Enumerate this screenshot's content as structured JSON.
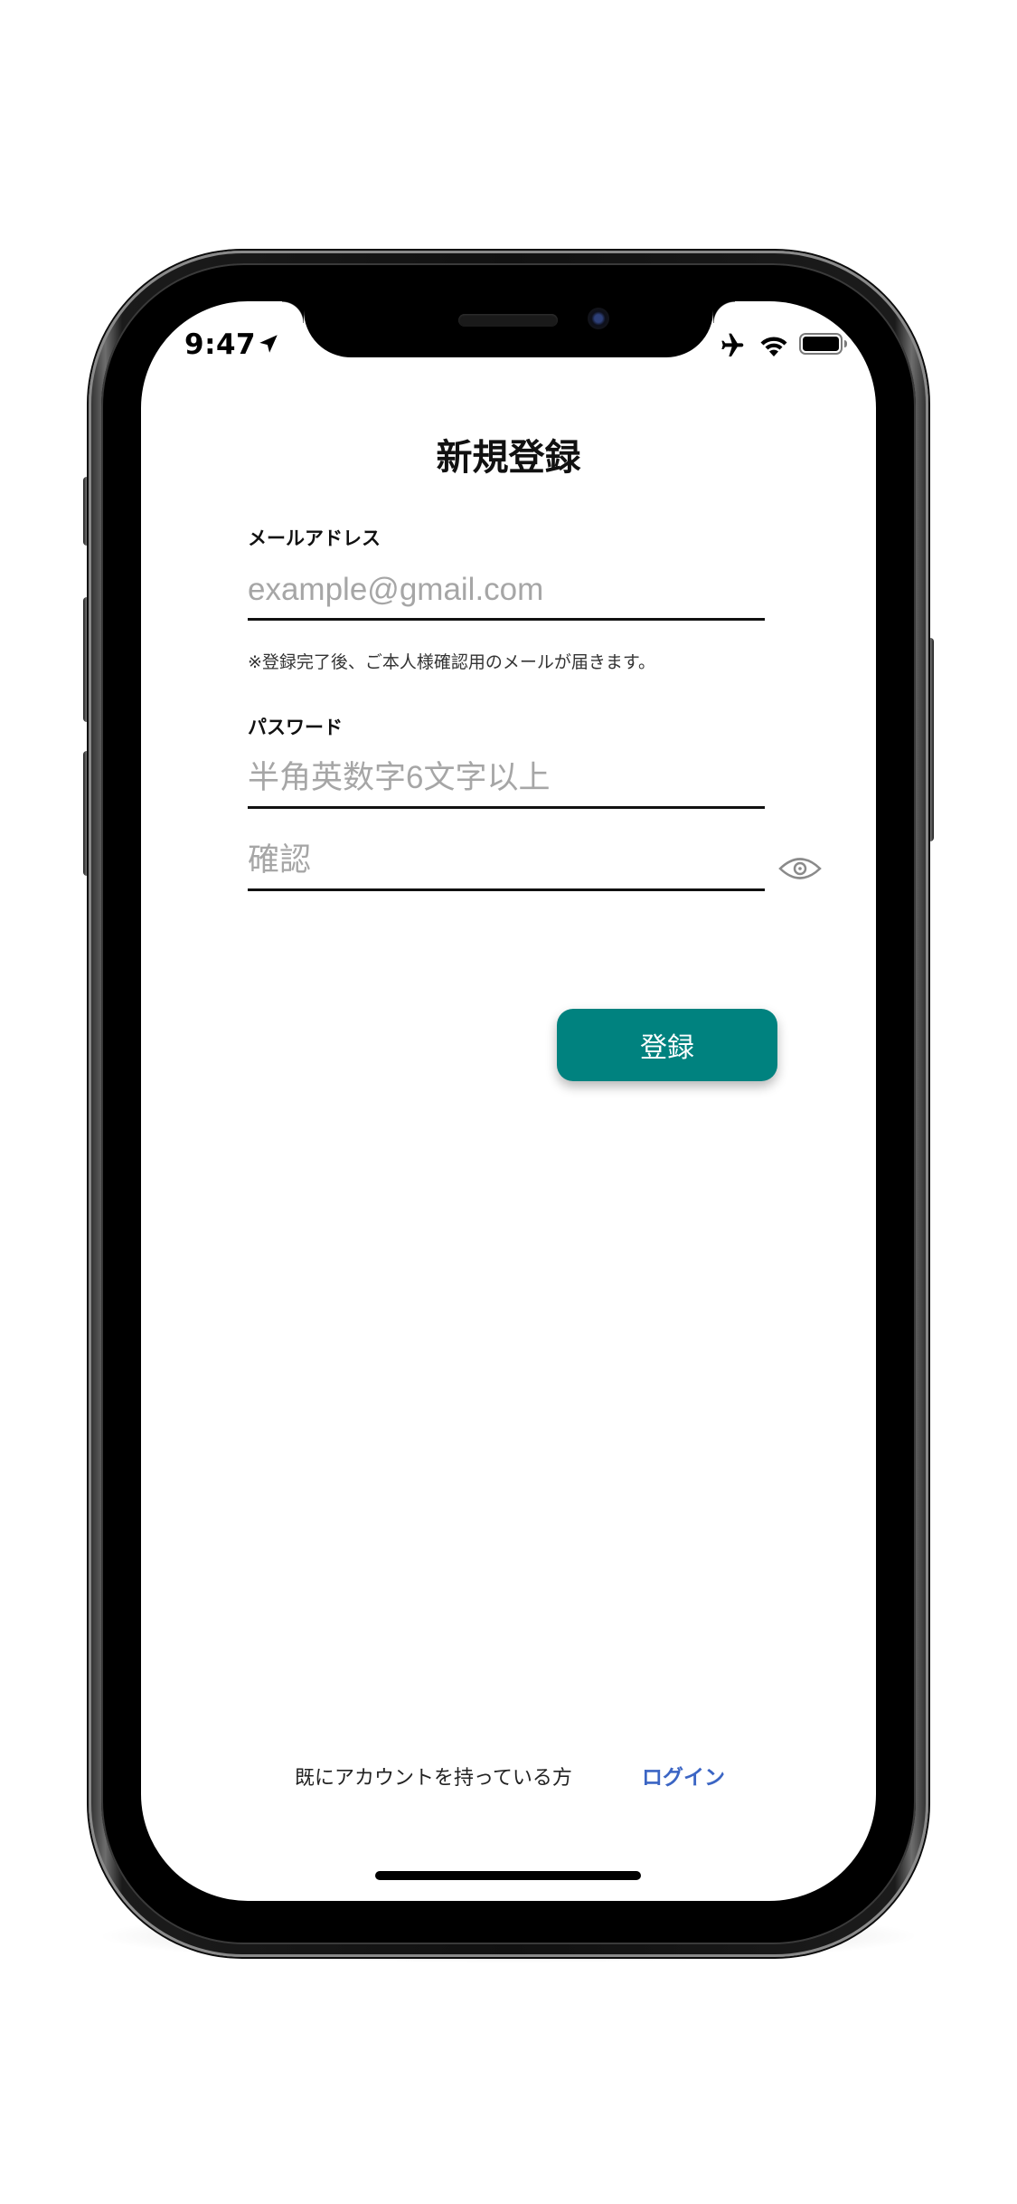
{
  "status_bar": {
    "time": "9:47",
    "icons": [
      "location-arrow-icon",
      "airplane-icon",
      "wifi-icon",
      "battery-icon"
    ]
  },
  "page": {
    "title": "新規登録"
  },
  "email": {
    "label": "メールアドレス",
    "value": "",
    "placeholder": "example@gmail.com",
    "helper": "※登録完了後、ご本人様確認用のメールが届きます。"
  },
  "password": {
    "label": "パスワード",
    "value": "",
    "placeholder": "半角英数字6文字以上",
    "confirm_value": "",
    "confirm_placeholder": "確認",
    "visibility_icon": "eye-icon"
  },
  "actions": {
    "register_label": "登録"
  },
  "footer": {
    "prompt": "既にアカウントを持っている方",
    "login_label": "ログイン"
  },
  "colors": {
    "accent": "#00827f",
    "link": "#3b65c4",
    "placeholder": "#a6a6a6",
    "text": "#111111"
  }
}
